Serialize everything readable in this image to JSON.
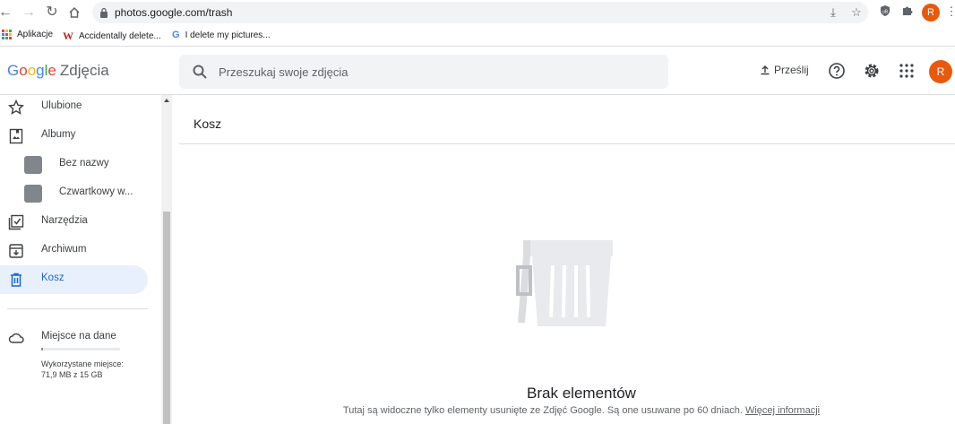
{
  "browser": {
    "url": "photos.google.com/trash",
    "profile_initial": "R",
    "bookmarks": [
      {
        "label": "Aplikacje",
        "icon": "apps-grid-icon"
      },
      {
        "label": "Accidentally delete...",
        "icon": "w-favicon"
      },
      {
        "label": "I delete my pictures...",
        "icon": "google-favicon"
      }
    ]
  },
  "header": {
    "logo_google": "Google",
    "logo_product": "Zdjęcia",
    "search_placeholder": "Przeszukaj swoje zdjęcia",
    "upload_label": "Prześlij",
    "avatar_initial": "R"
  },
  "sidebar": {
    "items": [
      {
        "label": "Ulubione",
        "icon": "star-icon"
      },
      {
        "label": "Albumy",
        "icon": "album-icon"
      },
      {
        "label": "Bez nazwy",
        "icon": "album-thumbnail"
      },
      {
        "label": "Czwartkowy w...",
        "icon": "album-thumbnail"
      },
      {
        "label": "Narzędzia",
        "icon": "utilities-icon"
      },
      {
        "label": "Archiwum",
        "icon": "archive-icon"
      },
      {
        "label": "Kosz",
        "icon": "trash-icon",
        "active": true
      }
    ],
    "storage": {
      "title": "Miejsce na dane",
      "used_text": "Wykorzystane miejsce: 71,9 MB z 15 GB",
      "used_fraction": 0.005
    }
  },
  "main": {
    "title": "Kosz",
    "empty_title": "Brak elementów",
    "empty_text": "Tutaj są widoczne tylko elementy usunięte ze Zdjęć Google. Są one usuwane po 60 dniach.",
    "learn_more": "Więcej informacji"
  },
  "colors": {
    "accent": "#1967d2",
    "active_bg": "#e8f0fe",
    "avatar": "#e8590c"
  }
}
